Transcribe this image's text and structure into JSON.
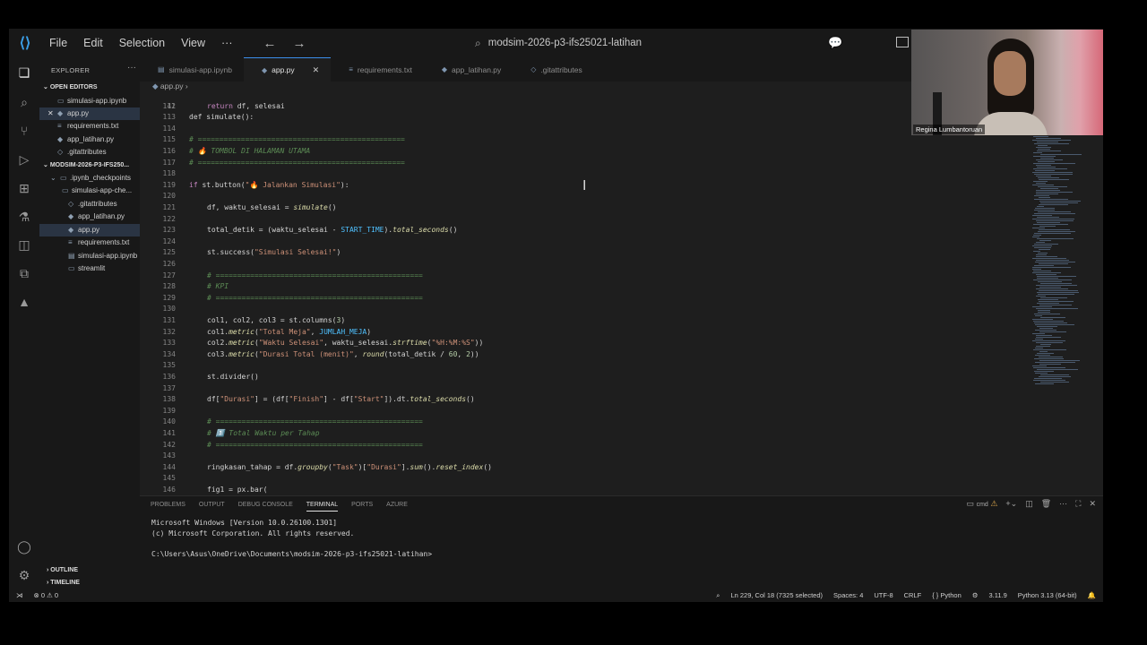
{
  "app": {
    "menu": [
      "File",
      "Edit",
      "Selection",
      "View"
    ],
    "more": "···",
    "search": "modsim-2026-p3-ifs25021-latihan"
  },
  "sidebar": {
    "title": "EXPLORER",
    "open_editors_title": "OPEN EDITORS",
    "open_editors": [
      "simulasi-app.ipynb",
      "app.py",
      "requirements.txt",
      "app_latihan.py",
      ".gitattributes"
    ],
    "project_title": "MODSIM-2026-P3-IFS250...",
    "tree": [
      ".ipynb_checkpoints",
      "simulasi-app-che...",
      ".gitattributes",
      "app_latihan.py",
      "app.py",
      "requirements.txt",
      "simulasi-app.ipynb",
      "streamlit"
    ],
    "outline": "OUTLINE",
    "timeline": "TIMELINE"
  },
  "tabs": [
    "simulasi-app.ipynb",
    "app.py",
    "requirements.txt",
    "app_latihan.py",
    ".gitattributes"
  ],
  "breadcrumb": "app.py",
  "editor": {
    "line_numbers": [
      "112",
      "113",
      "114",
      "115",
      "116",
      "117",
      "118",
      "119",
      "120",
      "121",
      "122",
      "123",
      "124",
      "125",
      "126",
      "127",
      "128",
      "129",
      "130",
      "131",
      "132",
      "133",
      "134",
      "135",
      "136",
      "137",
      "138",
      "139",
      "140",
      "141",
      "142",
      "143",
      "144",
      "145",
      "146"
    ],
    "top_partial": "def simulate():",
    "lines": [
      "return df, selesai",
      "",
      "",
      "# ================================================",
      "# 🔥 TOMBOL DI HALAMAN UTAMA",
      "# ================================================",
      "",
      "if st.button(\"🔥 Jalankan Simulasi\"):",
      "",
      "df, waktu_selesai = simulate()",
      "",
      "total_detik = (waktu_selesai - START_TIME).total_seconds()",
      "",
      "st.success(\"Simulasi Selesai!\")",
      "",
      "# ================================================",
      "# KPI",
      "# ================================================",
      "",
      "col1, col2, col3 = st.columns(3)",
      "col1.metric(\"Total Meja\", JUMLAH_MEJA)",
      "col2.metric(\"Waktu Selesai\", waktu_selesai.strftime(\"%H:%M:%S\"))",
      "col3.metric(\"Durasi Total (menit)\", round(total_detik / 60, 2))",
      "",
      "st.divider()",
      "",
      "df[\"Durasi\"] = (df[\"Finish\"] - df[\"Start\"]).dt.total_seconds()",
      "",
      "# ================================================",
      "# 1️⃣ Total Waktu per Tahap",
      "# ================================================",
      "",
      "ringkasan_tahap = df.groupby(\"Task\")[\"Durasi\"].sum().reset_index()",
      "",
      "fig1 = px.bar("
    ]
  },
  "panel": {
    "tabs": [
      "PROBLEMS",
      "OUTPUT",
      "DEBUG CONSOLE",
      "TERMINAL",
      "PORTS",
      "AZURE"
    ],
    "active_tab": "TERMINAL",
    "shell": "cmd",
    "terminal": [
      "Microsoft Windows [Version 10.0.26100.1301]",
      "(c) Microsoft Corporation. All rights reserved.",
      "",
      "C:\\Users\\Asus\\OneDrive\\Documents\\modsim-2026-p3-ifs25021-latihan>"
    ]
  },
  "statusbar": {
    "problems": "⊗ 0 ⚠ 0",
    "position": "Ln 229, Col 18 (7325 selected)",
    "spaces": "Spaces: 4",
    "encoding": "UTF-8",
    "eol": "CRLF",
    "language": "{ } Python",
    "python_version": "3.11.9",
    "interpreter": "Python 3.13 (64-bit)"
  },
  "webcam": {
    "name": "Regina Lumbantoruan"
  },
  "colors": {
    "accent": "#3b8eea",
    "editor_bg": "#1e1e1e",
    "chrome_bg": "#181818"
  }
}
